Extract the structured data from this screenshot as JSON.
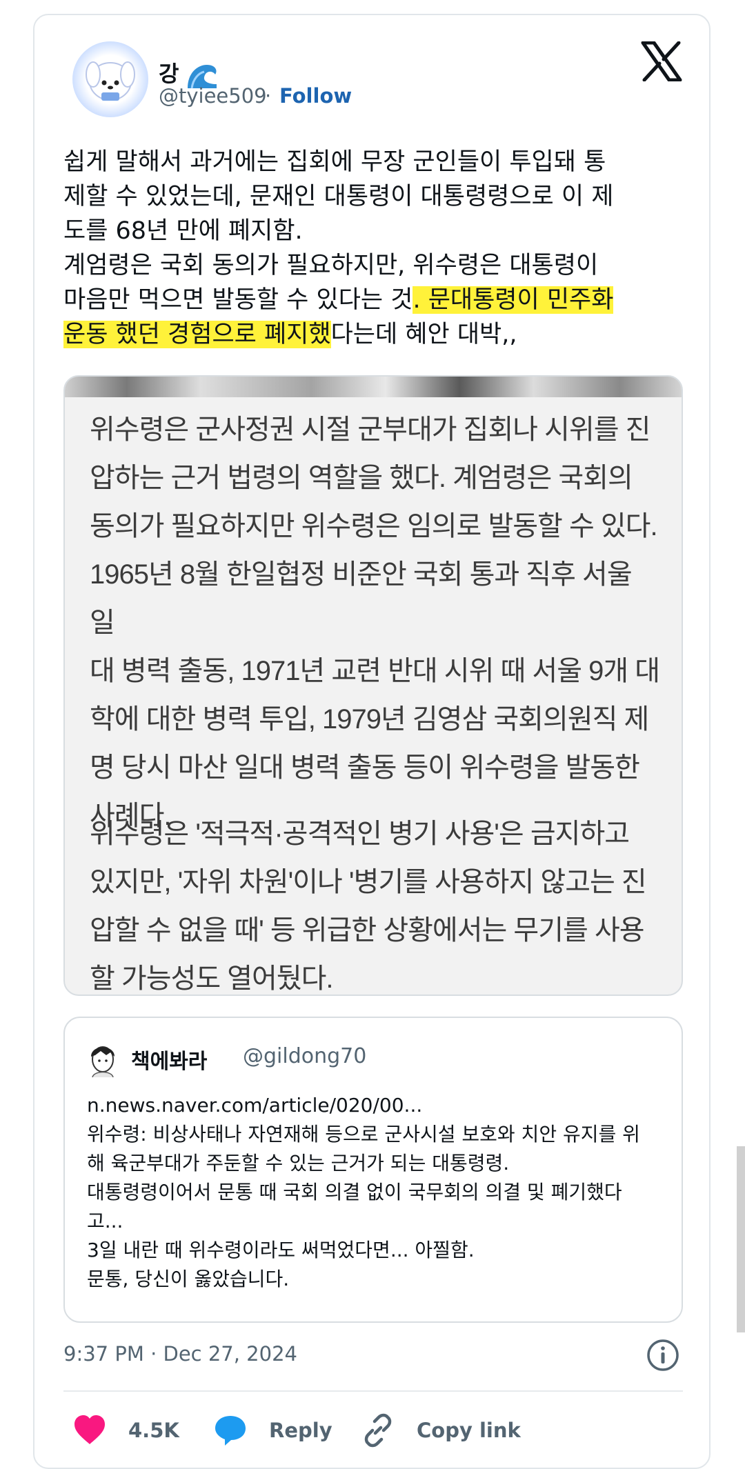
{
  "author": {
    "name": "강",
    "handle": "@tyiee509",
    "separator": "·",
    "follow_label": "Follow"
  },
  "tweet": {
    "text_plain": "쉽게 말해서 과거에는 집회에 무장 군인들이 투입돼 통\n제할 수 있었는데, 문재인 대통령이 대통령령으로 이 제\n도를 68년 만에 폐지함.\n계엄령은 국회 동의가 필요하지만, 위수령은 대통령이\n마음만 먹으면 발동할 수 있다는 것",
    "text_highlight": ". 문대통령이 민주화\n운동 했던 경험으로 폐지했",
    "text_end": "다는데 혜안 대박,,"
  },
  "image": {
    "paragraph1": "위수령은 군사정권 시절 군부대가 집회나 시위를 진\n압하는 근거 법령의 역할을 했다. 계엄령은 국회의\n동의가 필요하지만 위수령은 임의로 발동할 수 있다.\n1965년 8월 한일협정 비준안 국회 통과 직후 서울 일\n대 병력 출동, 1971년 교련 반대 시위 때 서울 9개 대\n학에 대한 병력 투입, 1979년 김영삼 국회의원직 제\n명 당시 마산 일대 병력 출동 등이 위수령을 발동한\n사례다.",
    "paragraph2": "위수령은 '적극적·공격적인 병기 사용'은 금지하고\n있지만, '자위 차원'이나 '병기를 사용하지 않고는 진\n압할 수 없을 때' 등 위급한 상황에서는 무기를 사용\n할 가능성도 열어뒀다."
  },
  "quote": {
    "name": "책에봐라",
    "handle": "@gildong70",
    "body": "n.news.naver.com/article/020/00...\n위수령: 비상사태나 자연재해 등으로 군사시설 보호와 치안 유지를 위\n해 육군부대가 주둔할 수 있는 근거가 되는 대통령령.\n대통령령이어서 문통 때 국회 의결 없이 국무회의 의결 및 폐기했다\n고...\n3일 내란 때 위수령이라도 써먹었다면... 아찔함.\n문통, 당신이 옳았습니다."
  },
  "meta": {
    "timestamp": "9:37 PM · Dec 27, 2024"
  },
  "actions": {
    "like_count": "4.5K",
    "reply_label": "Reply",
    "copy_label": "Copy link"
  },
  "colors": {
    "follow": "#1d64b0",
    "like": "#f91880",
    "reply": "#1d9bf0",
    "highlight": "#fff23a"
  },
  "icons": [
    "wave-icon",
    "x-logo-icon",
    "info-icon",
    "heart-icon",
    "reply-bubble-icon",
    "link-icon"
  ]
}
